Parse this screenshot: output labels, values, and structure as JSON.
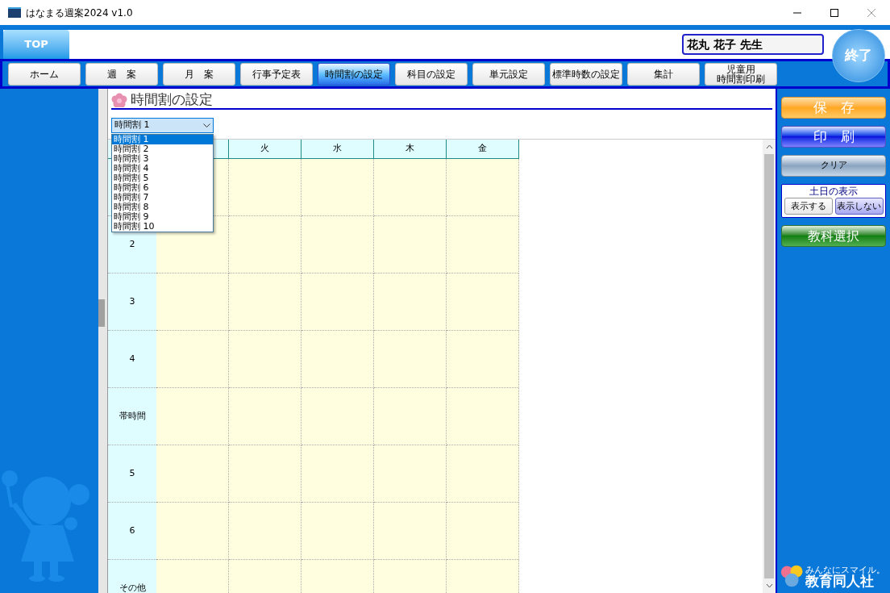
{
  "window": {
    "title": "はなまる週案2024 v1.0"
  },
  "top_tab": {
    "label": "TOP",
    "selected": true
  },
  "user_name": "花丸 花子 先生",
  "exit_button": "終了",
  "nav": [
    {
      "label": "ホーム",
      "selected": false
    },
    {
      "label": "週　案",
      "selected": false
    },
    {
      "label": "月　案",
      "selected": false
    },
    {
      "label": "行事予定表",
      "selected": false
    },
    {
      "label": "時間割の設定",
      "selected": true
    },
    {
      "label": "科目の設定",
      "selected": false
    },
    {
      "label": "単元設定",
      "selected": false
    },
    {
      "label": "標準時数の設定",
      "selected": false
    },
    {
      "label": "集計",
      "selected": false
    },
    {
      "lines": [
        "児童用",
        "時間割印刷"
      ],
      "selected": false
    }
  ],
  "page_title": "時間割の設定",
  "timetable_select": {
    "value": "時間割 1",
    "expanded": true,
    "options": [
      {
        "label": "時間割 1",
        "selected": true
      },
      {
        "label": "時間割 2",
        "selected": false
      },
      {
        "label": "時間割 3",
        "selected": false
      },
      {
        "label": "時間割 4",
        "selected": false
      },
      {
        "label": "時間割 5",
        "selected": false
      },
      {
        "label": "時間割 6",
        "selected": false
      },
      {
        "label": "時間割 7",
        "selected": false
      },
      {
        "label": "時間割 8",
        "selected": false
      },
      {
        "label": "時間割 9",
        "selected": false
      },
      {
        "label": "時間割 10",
        "selected": false
      }
    ]
  },
  "grid": {
    "columns": [
      "火",
      "水",
      "木",
      "金"
    ],
    "rows": [
      "2",
      "3",
      "4",
      "帯時間",
      "5",
      "6",
      "その他"
    ]
  },
  "actions": {
    "save": "保　存",
    "print": "印　刷",
    "clear": "クリア"
  },
  "weekend_display": {
    "title": "土日の表示",
    "options": [
      {
        "label": "表示する",
        "selected": false
      },
      {
        "label": "表示しない",
        "selected": true
      }
    ]
  },
  "subject_select": "教科選択",
  "logo": {
    "tagline": "みんなにスマイル。",
    "name": "教育同人社"
  }
}
